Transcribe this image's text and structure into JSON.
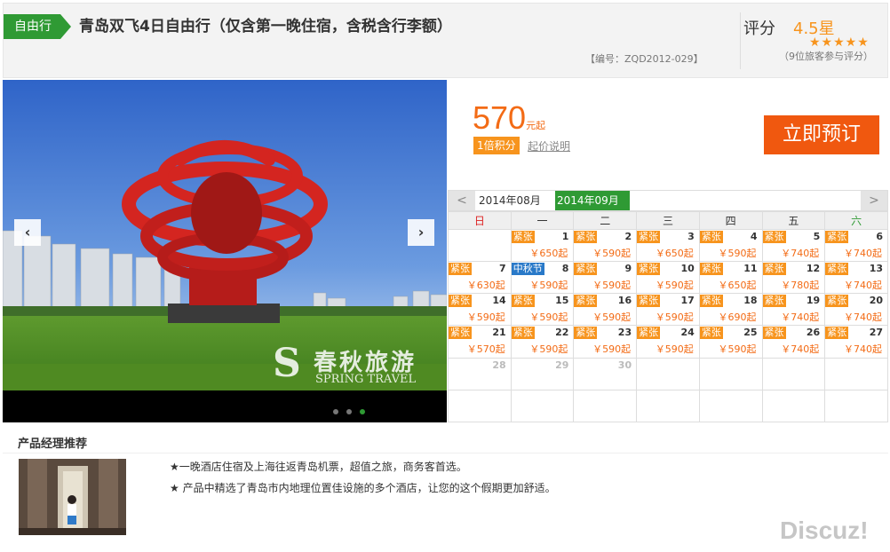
{
  "header": {
    "tag": "自由行",
    "title": "青岛双飞4日自由行（仅含第一晚住宿，含税含行李额）",
    "code": "【编号：ZQD2012-029】",
    "score_label": "评分",
    "score_value": "4.5星",
    "stars": "★★★★★",
    "reviews": "（9位旅客参与评分）"
  },
  "gallery": {
    "prev_icon": "‹",
    "next_icon": "›",
    "watermark_cn": "春秋旅游",
    "watermark_en": "SPRING TRAVEL",
    "watermark_s": "S",
    "slide_count": 3,
    "active_slide": 3
  },
  "price": {
    "amount": "570",
    "unit": "元起",
    "points": "1倍积分",
    "note": "起价说明",
    "book_label": "立即预订"
  },
  "calendar": {
    "prev_icon": "<",
    "next_icon": ">",
    "month_a": "2014年08月",
    "month_b": "2014年09月",
    "weekdays": [
      "日",
      "一",
      "二",
      "三",
      "四",
      "五",
      "六"
    ],
    "rows": [
      [
        {
          "day": "",
          "badge": "",
          "price": ""
        },
        {
          "day": "1",
          "badge": "紧张",
          "price": "￥650起"
        },
        {
          "day": "2",
          "badge": "紧张",
          "price": "￥590起"
        },
        {
          "day": "3",
          "badge": "紧张",
          "price": "￥650起"
        },
        {
          "day": "4",
          "badge": "紧张",
          "price": "￥590起"
        },
        {
          "day": "5",
          "badge": "紧张",
          "price": "￥740起"
        },
        {
          "day": "6",
          "badge": "紧张",
          "price": "￥740起"
        }
      ],
      [
        {
          "day": "7",
          "badge": "紧张",
          "price": "￥630起"
        },
        {
          "day": "8",
          "badge": "中秋节",
          "badge_type": "holiday",
          "price": "￥590起"
        },
        {
          "day": "9",
          "badge": "紧张",
          "price": "￥590起"
        },
        {
          "day": "10",
          "badge": "紧张",
          "price": "￥590起"
        },
        {
          "day": "11",
          "badge": "紧张",
          "price": "￥650起"
        },
        {
          "day": "12",
          "badge": "紧张",
          "price": "￥780起"
        },
        {
          "day": "13",
          "badge": "紧张",
          "price": "￥740起"
        }
      ],
      [
        {
          "day": "14",
          "badge": "紧张",
          "price": "￥590起"
        },
        {
          "day": "15",
          "badge": "紧张",
          "price": "￥590起"
        },
        {
          "day": "16",
          "badge": "紧张",
          "price": "￥590起"
        },
        {
          "day": "17",
          "badge": "紧张",
          "price": "￥590起"
        },
        {
          "day": "18",
          "badge": "紧张",
          "price": "￥690起"
        },
        {
          "day": "19",
          "badge": "紧张",
          "price": "￥740起"
        },
        {
          "day": "20",
          "badge": "紧张",
          "price": "￥740起"
        }
      ],
      [
        {
          "day": "21",
          "badge": "紧张",
          "price": "￥570起"
        },
        {
          "day": "22",
          "badge": "紧张",
          "price": "￥590起"
        },
        {
          "day": "23",
          "badge": "紧张",
          "price": "￥590起"
        },
        {
          "day": "24",
          "badge": "紧张",
          "price": "￥590起"
        },
        {
          "day": "25",
          "badge": "紧张",
          "price": "￥590起"
        },
        {
          "day": "26",
          "badge": "紧张",
          "price": "￥740起"
        },
        {
          "day": "27",
          "badge": "紧张",
          "price": "￥740起"
        }
      ],
      [
        {
          "day": "28",
          "badge": "",
          "price": "",
          "past": true
        },
        {
          "day": "29",
          "badge": "",
          "price": "",
          "past": true
        },
        {
          "day": "30",
          "badge": "",
          "price": "",
          "past": true
        },
        {
          "day": "",
          "badge": "",
          "price": ""
        },
        {
          "day": "",
          "badge": "",
          "price": ""
        },
        {
          "day": "",
          "badge": "",
          "price": ""
        },
        {
          "day": "",
          "badge": "",
          "price": ""
        }
      ],
      [
        {
          "day": "",
          "badge": "",
          "price": ""
        },
        {
          "day": "",
          "badge": "",
          "price": ""
        },
        {
          "day": "",
          "badge": "",
          "price": ""
        },
        {
          "day": "",
          "badge": "",
          "price": ""
        },
        {
          "day": "",
          "badge": "",
          "price": ""
        },
        {
          "day": "",
          "badge": "",
          "price": ""
        },
        {
          "day": "",
          "badge": "",
          "price": ""
        }
      ]
    ]
  },
  "recommend": {
    "title": "产品经理推荐",
    "items": [
      "★一晚酒店住宿及上海往返青岛机票，超值之旅，商务客首选。",
      "★ 产品中精选了青岛市内地理位置佳设施的多个酒店，让您的这个假期更加舒适。"
    ]
  },
  "watermark": "Discuz!",
  "colors": {
    "green": "#2f9a34",
    "orange": "#f7941d",
    "price": "#f36b15",
    "book": "#f0580f",
    "holiday": "#2979c8"
  }
}
